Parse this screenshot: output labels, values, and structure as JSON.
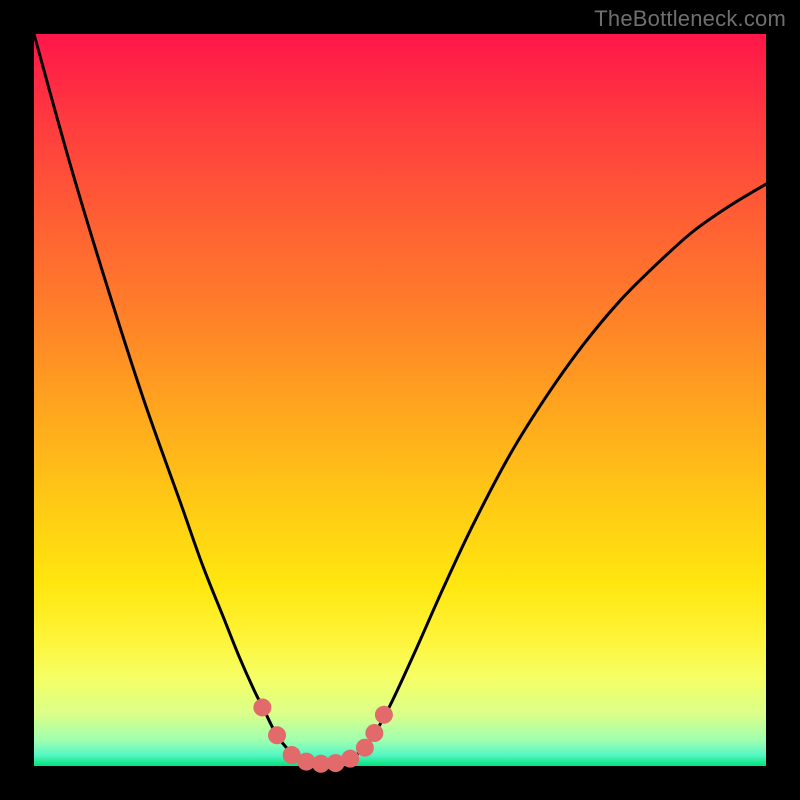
{
  "watermark": "TheBottleneck.com",
  "gradient_stops": {
    "g0": "#ff1649",
    "g1": "#ff3b3f",
    "g2": "#ff5e34",
    "g3": "#ff7f29",
    "g4": "#ffa21f",
    "g5": "#ffc416",
    "g6": "#ffe60f",
    "g7": "#fff335",
    "g8": "#f6ff66",
    "g9": "#d9ff8a",
    "g10": "#9fffb0",
    "g11": "#55f7c4",
    "g12": "#00e27a"
  },
  "curve_color": "#000000",
  "curve_stroke_width": 3,
  "marker_color": "#e26a6a",
  "marker_radius": 9,
  "chart_data": {
    "type": "line",
    "title": "",
    "xlabel": "",
    "ylabel": "",
    "xlim": [
      0,
      1
    ],
    "ylim": [
      0,
      1
    ],
    "legend": [],
    "series": [
      {
        "name": "bottleneck-curve",
        "comment": "Normalized (0..1) coordinates of the black V/U-shaped curve as read from the plot. Origin = top-left of the gradient square; y increases downward (screen space).",
        "points": [
          {
            "x": 0.0,
            "y": 0.0
          },
          {
            "x": 0.05,
            "y": 0.18
          },
          {
            "x": 0.1,
            "y": 0.345
          },
          {
            "x": 0.15,
            "y": 0.5
          },
          {
            "x": 0.2,
            "y": 0.64
          },
          {
            "x": 0.23,
            "y": 0.725
          },
          {
            "x": 0.26,
            "y": 0.8
          },
          {
            "x": 0.28,
            "y": 0.85
          },
          {
            "x": 0.3,
            "y": 0.895
          },
          {
            "x": 0.315,
            "y": 0.925
          },
          {
            "x": 0.33,
            "y": 0.955
          },
          {
            "x": 0.345,
            "y": 0.975
          },
          {
            "x": 0.36,
            "y": 0.988
          },
          {
            "x": 0.38,
            "y": 0.995
          },
          {
            "x": 0.4,
            "y": 0.997
          },
          {
            "x": 0.42,
            "y": 0.995
          },
          {
            "x": 0.44,
            "y": 0.985
          },
          {
            "x": 0.455,
            "y": 0.97
          },
          {
            "x": 0.47,
            "y": 0.948
          },
          {
            "x": 0.49,
            "y": 0.91
          },
          {
            "x": 0.52,
            "y": 0.845
          },
          {
            "x": 0.56,
            "y": 0.755
          },
          {
            "x": 0.6,
            "y": 0.67
          },
          {
            "x": 0.65,
            "y": 0.575
          },
          {
            "x": 0.7,
            "y": 0.495
          },
          {
            "x": 0.75,
            "y": 0.425
          },
          {
            "x": 0.8,
            "y": 0.365
          },
          {
            "x": 0.85,
            "y": 0.315
          },
          {
            "x": 0.9,
            "y": 0.27
          },
          {
            "x": 0.95,
            "y": 0.235
          },
          {
            "x": 1.0,
            "y": 0.205
          }
        ]
      },
      {
        "name": "markers",
        "comment": "Salmon dots along the bottom of the curve, normalized screen-space coords.",
        "points": [
          {
            "x": 0.312,
            "y": 0.92
          },
          {
            "x": 0.332,
            "y": 0.958
          },
          {
            "x": 0.352,
            "y": 0.985
          },
          {
            "x": 0.372,
            "y": 0.994
          },
          {
            "x": 0.392,
            "y": 0.997
          },
          {
            "x": 0.412,
            "y": 0.996
          },
          {
            "x": 0.432,
            "y": 0.99
          },
          {
            "x": 0.452,
            "y": 0.975
          },
          {
            "x": 0.465,
            "y": 0.955
          },
          {
            "x": 0.478,
            "y": 0.93
          }
        ]
      }
    ]
  }
}
